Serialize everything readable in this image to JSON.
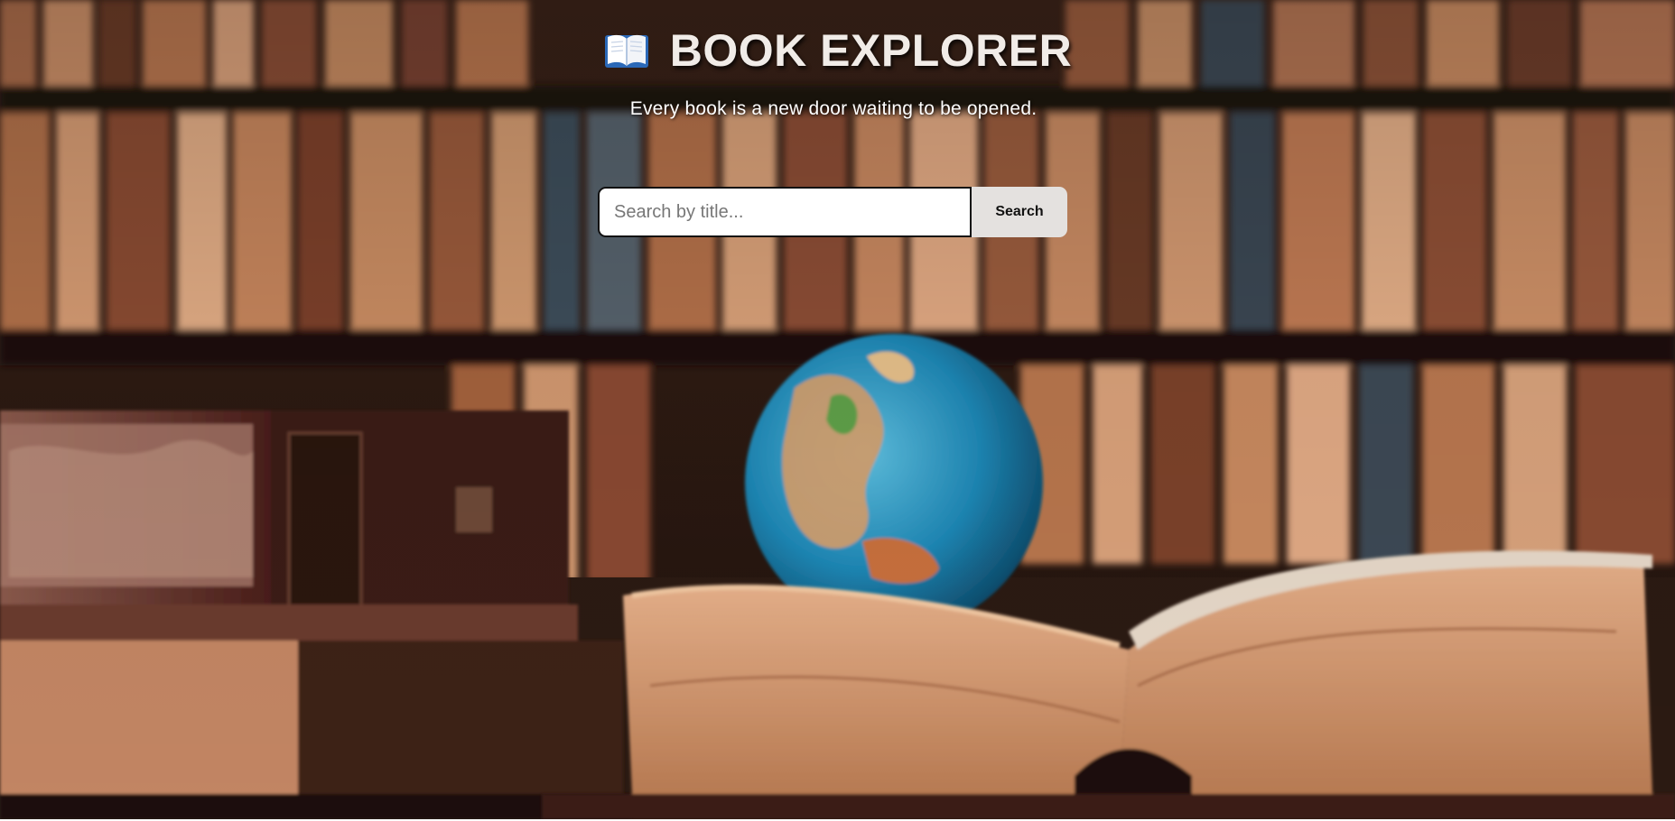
{
  "header": {
    "icon": "open-book-icon",
    "title": "BOOK EXPLORER",
    "tagline": "Every book is a new door waiting to be opened."
  },
  "search": {
    "placeholder": "Search by title...",
    "value": "",
    "button_label": "Search"
  },
  "colors": {
    "title_text": "#f1ece8",
    "button_bg": "#e4e1df",
    "input_border": "#111111"
  }
}
